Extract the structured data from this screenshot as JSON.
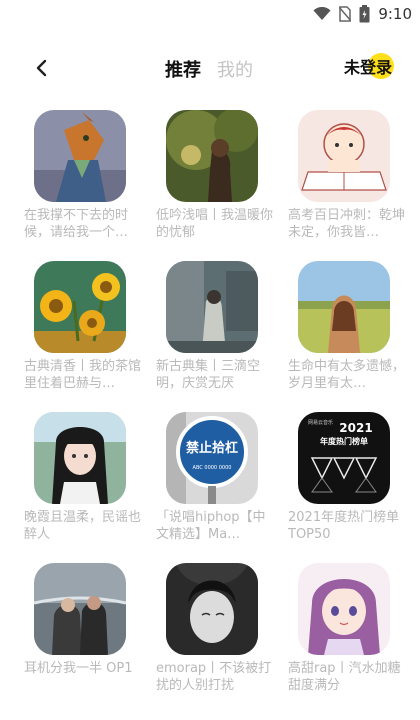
{
  "status": {
    "time": "9:10"
  },
  "header": {
    "tabs": [
      {
        "label": "推荐"
      },
      {
        "label": "我的"
      }
    ],
    "login_label": "未登录"
  },
  "playlists": [
    {
      "title": "在我撑不下去的时候，请给我一个…"
    },
    {
      "title": "低吟浅唱丨我温暖你的忧郁"
    },
    {
      "title": "高考百日冲刺：乾坤未定，你我皆…"
    },
    {
      "title": "古典清香丨我的茶馆里住着巴赫与…"
    },
    {
      "title": "新古典集丨三滴空明，庆赏无厌"
    },
    {
      "title": "生命中有太多遗憾，岁月里有太…"
    },
    {
      "title": "晚霞且温柔，民谣也醉人"
    },
    {
      "title": "「说唱hiphop【中文精选】Ma…"
    },
    {
      "title": "2021年度热门榜单TOP50"
    },
    {
      "title": "耳机分我一半 OP1"
    },
    {
      "title": "emorap丨不该被打扰的人别打扰"
    },
    {
      "title": "高甜rap丨汽水加糖 甜度满分"
    }
  ],
  "cover_text": {
    "sign": "禁止拾杠",
    "sign_small": "ABC 0000 0000",
    "chart_small": "网易云音乐",
    "chart_year": "2021",
    "chart_label": "年度热门榜单"
  },
  "colors": {
    "accent": "#ffde1a",
    "muted": "#b9b9b9"
  }
}
